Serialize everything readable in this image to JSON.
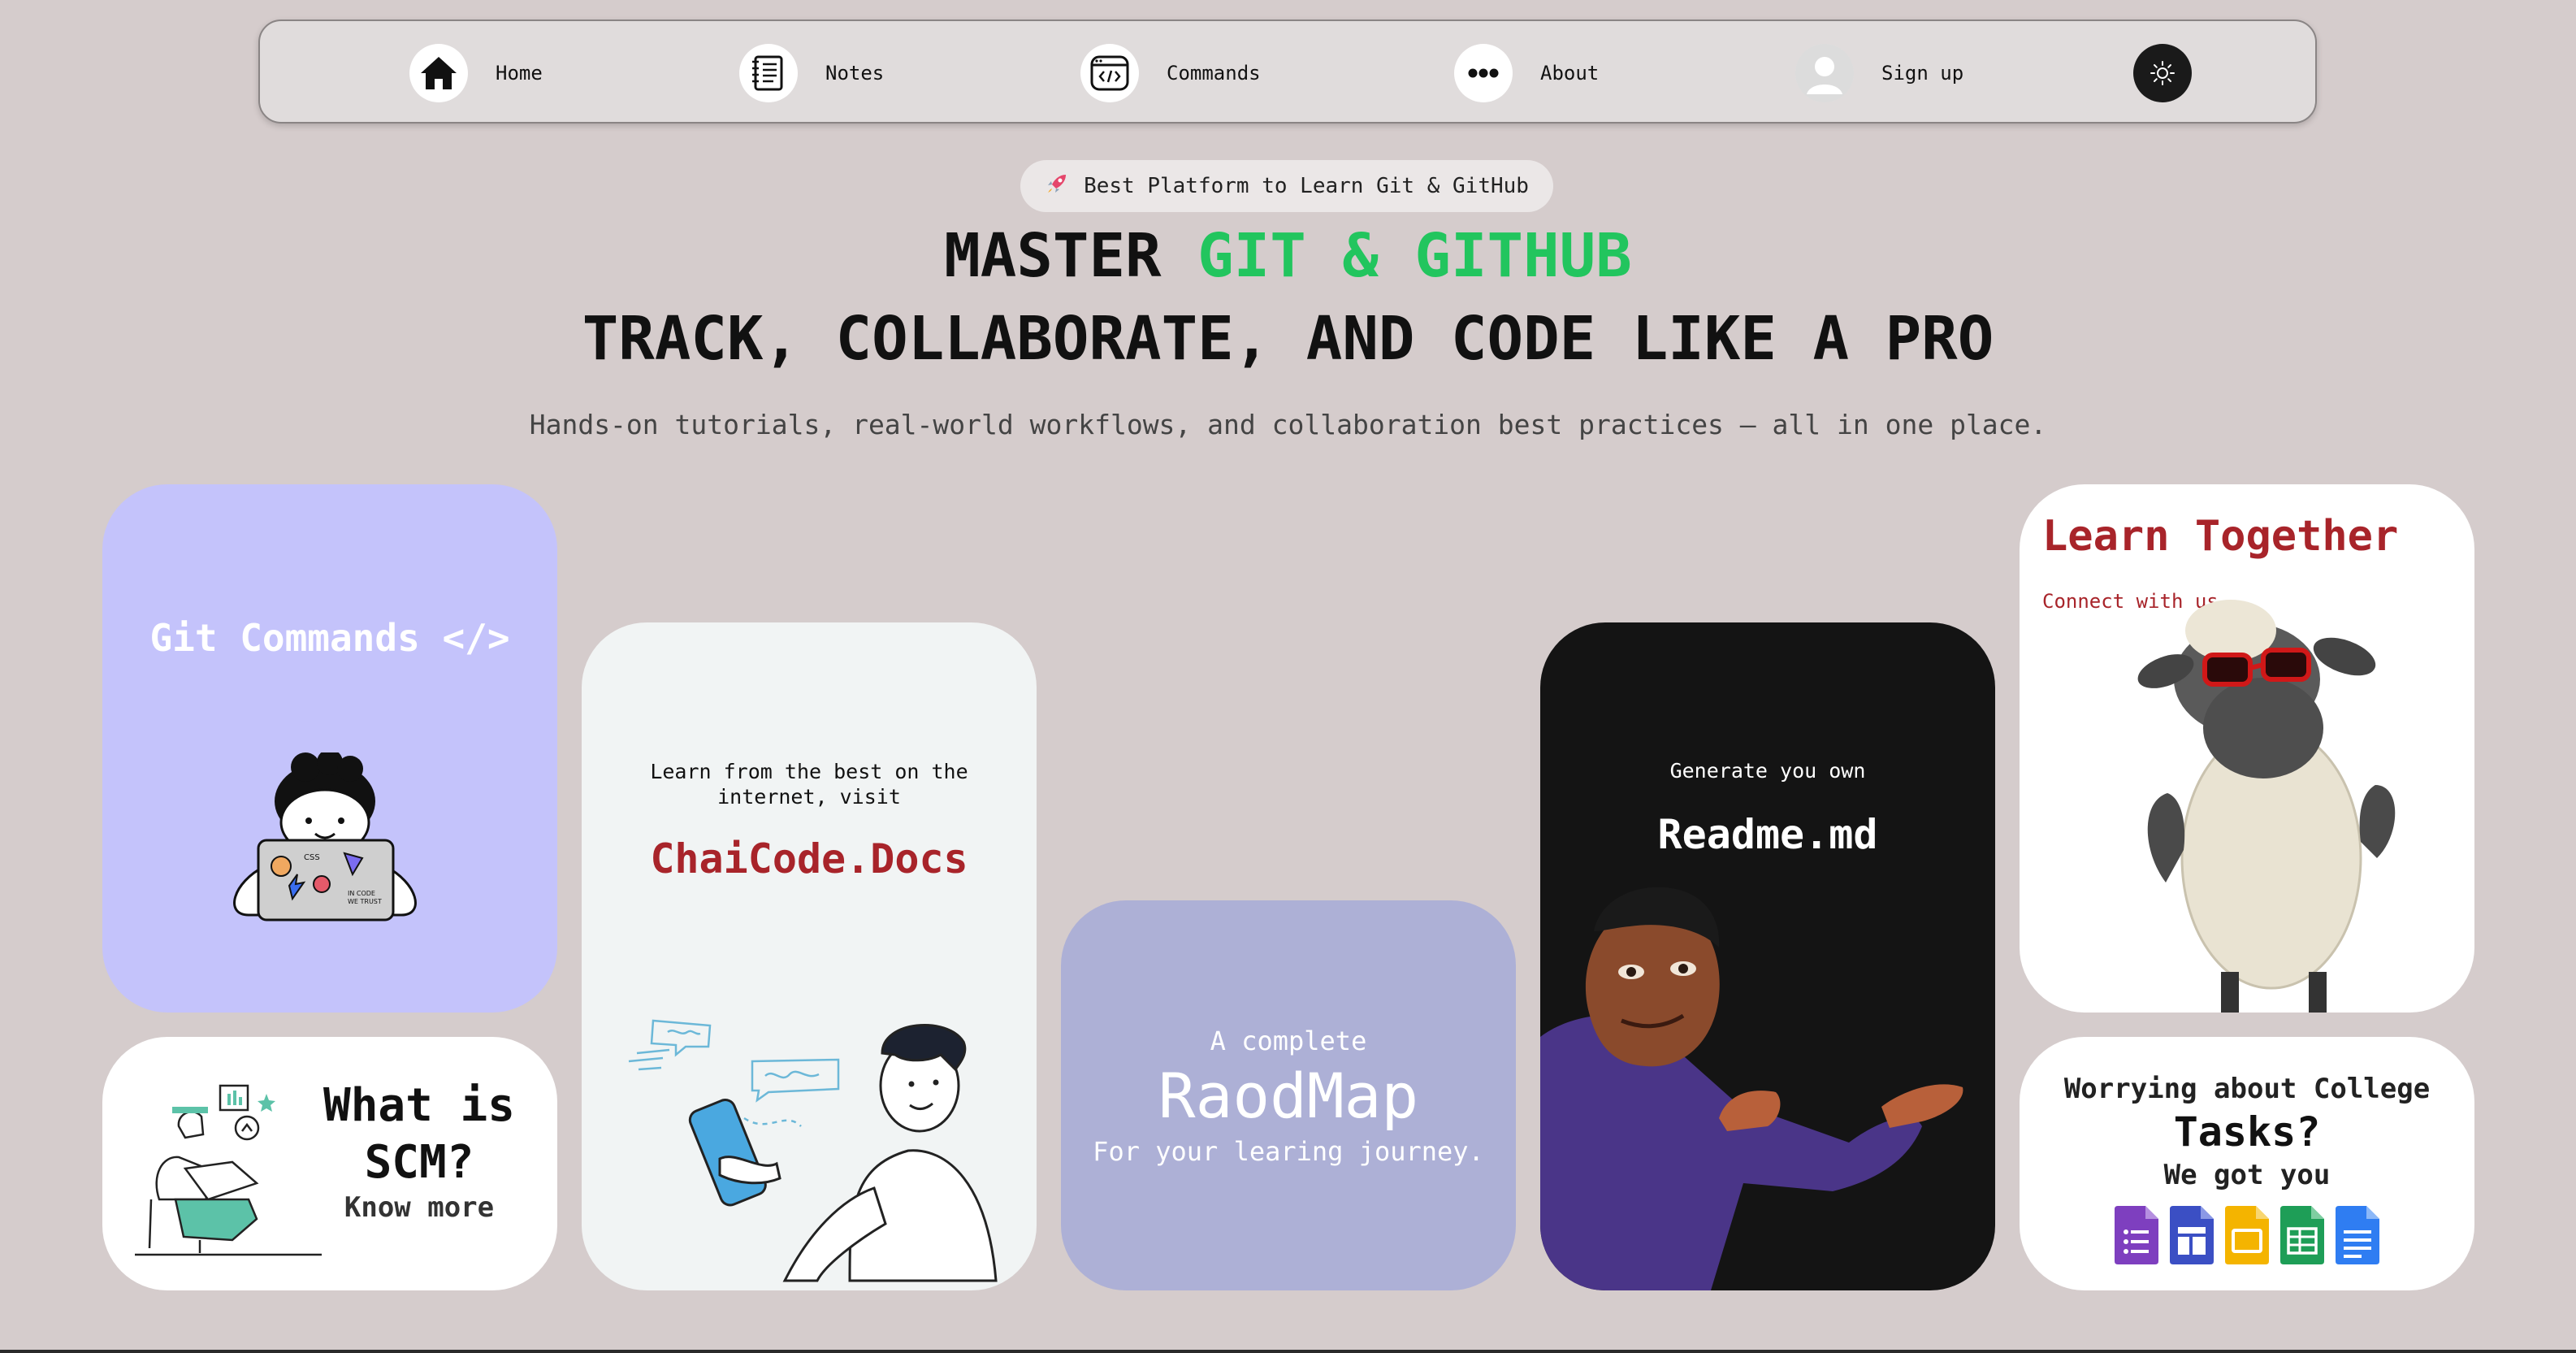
{
  "nav": {
    "items": [
      {
        "label": "Home",
        "icon": "home-icon"
      },
      {
        "label": "Notes",
        "icon": "notes-icon"
      },
      {
        "label": "Commands",
        "icon": "code-window-icon"
      },
      {
        "label": "About",
        "icon": "more-dots-icon"
      },
      {
        "label": "Sign up",
        "icon": "user-avatar-icon"
      }
    ],
    "theme_toggle_icon": "sun-icon"
  },
  "hero": {
    "badge": "Best Platform to Learn Git & GitHub",
    "badge_icon": "rocket-icon",
    "title_part1": "MASTER ",
    "title_accent": "GIT & GITHUB",
    "title_line2": "TRACK, COLLABORATE, AND CODE LIKE A PRO",
    "subtitle": "Hands-on tutorials, real-world workflows, and collaboration best practices – all in one place.",
    "accent_color": "#22c55e"
  },
  "cards": {
    "git_commands": {
      "title": "Git Commands </>"
    },
    "scm": {
      "title": "What is SCM?",
      "link": "Know more"
    },
    "docs": {
      "text": "Learn from the best on the internet, visit",
      "link": "ChaiCode.Docs"
    },
    "roadmap": {
      "pre": "A complete",
      "title": "RaodMap",
      "sub": "For your learing journey."
    },
    "readme": {
      "pre": "Generate you own",
      "title": "Readme.md"
    },
    "learn": {
      "title": "Learn Together",
      "sub": "Connect with us"
    },
    "tasks": {
      "line1": "Worrying about College",
      "line2": "Tasks?",
      "line3": "We got you",
      "icons": [
        "google-forms-icon",
        "google-sites-icon",
        "google-slides-icon",
        "google-sheets-icon",
        "google-docs-icon"
      ]
    }
  },
  "colors": {
    "background": "#d5cccc",
    "card_git": "#c4c3fb",
    "card_roadmap": "#adb0d6",
    "card_readme": "#141414",
    "link_red": "#a8242a"
  }
}
